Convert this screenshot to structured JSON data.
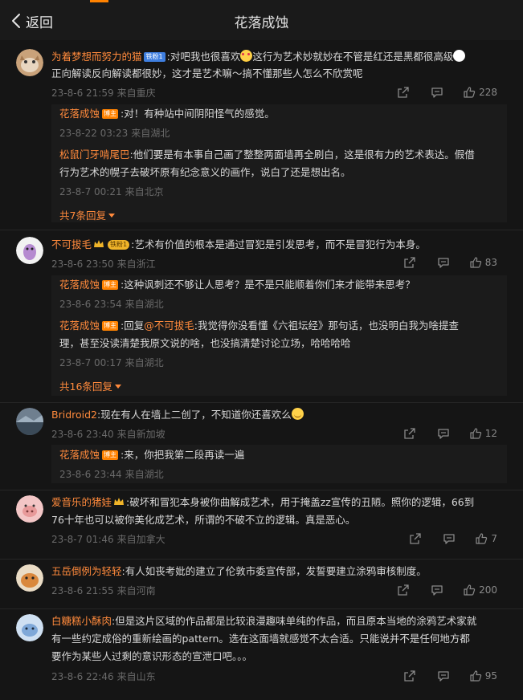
{
  "header": {
    "back_label": "返回",
    "title": "花落成蚀"
  },
  "comments": [
    {
      "username": "为着梦想而努力的猫",
      "badge": "铁粉1",
      "text_line1": ":对吧我也很喜欢",
      "text_line1b": "这行为艺术妙就妙在不管是红还是黑都很高级",
      "text_line2": "正向解读反向解读都很妙，这才是艺术嘛～搞不懂那些人怎么不欣赏呢",
      "time": "23-8-6 21:59",
      "location": "来自重庆",
      "likes": "228",
      "replies": [
        {
          "username": "花落成蚀",
          "badge": "博主",
          "text": ":对！有种站中间阴阳怪气的感觉。",
          "time": "23-8-22 03:23",
          "location": "来自湖北"
        },
        {
          "username": "松鼠门牙啃尾巴",
          "text1": ":他们要是有本事自己画了整整两面墙再全刷白，这是很有力的艺术表达。假借",
          "text2": "行为艺术的幌子去破坏原有纪念意义的画作，说白了还是想出名。",
          "time": "23-8-7 00:21",
          "location": "来自北京"
        }
      ],
      "more": "共7条回复"
    },
    {
      "username": "不可拔毛",
      "badge": "铁粉1",
      "text": ":艺术有价值的根本是通过冒犯是引发思考，而不是冒犯行为本身。",
      "time": "23-8-6 23:50",
      "location": "来自浙江",
      "likes": "83",
      "replies": [
        {
          "username": "花落成蚀",
          "badge": "博主",
          "text": ":这种讽刺还不够让人思考？是不是只能顺着你们来才能带来思考？",
          "time": "23-8-6 23:54",
          "location": "来自湖北"
        },
        {
          "username": "花落成蚀",
          "badge": "博主",
          "text_pre": ":回复",
          "mention": "@不可拔毛",
          "text1": ":我觉得你没看懂《六祖坛经》那句话，也没明白我为啥提查",
          "text2": "理，甚至没读清楚我原文说的啥，也没搞清楚讨论立场，哈哈哈哈",
          "time": "23-8-7 00:17",
          "location": "来自湖北"
        }
      ],
      "more": "共16条回复"
    },
    {
      "username": "Bridroid2",
      "text": ":现在有人在墙上二创了，不知道你还喜欢么",
      "time": "23-8-6 23:40",
      "location": "来自新加坡",
      "likes": "12",
      "replies": [
        {
          "username": "花落成蚀",
          "badge": "博主",
          "text": ":来，你把我第二段再读一遍",
          "time": "23-8-6 23:44",
          "location": "来自湖北"
        }
      ]
    },
    {
      "username": "爱音乐的猪娃",
      "text1": ":破坏和冒犯本身被你曲解成艺术，用于掩盖zz宣传的丑陋。照你的逻辑，66到",
      "text2": "76十年也可以被你美化成艺术，所谓的不破不立的逻辑。真是恶心。",
      "time": "23-8-7 01:46",
      "location": "来自加拿大",
      "likes": "7"
    },
    {
      "username": "五岳倒例为轻轻",
      "text": ":有人如丧考妣的建立了伦敦市委宣传部，发誓要建立涂鸦审核制度。",
      "time": "23-8-6 21:55",
      "location": "来自河南",
      "likes": "200"
    },
    {
      "username": "白糖糕小酥肉",
      "text1": ":但是这片区域的作品都是比较浪漫趣味单纯的作品，而且原本当地的涂鸦艺术家就",
      "text2": "有一些约定成俗的重新绘画的pattern。选在这面墙就感觉不太合适。只能说并不是任何地方都",
      "text3": "要作为某些人过剩的意识形态的宣泄口吧。。。",
      "time": "23-8-6 22:46",
      "location": "来自山东",
      "likes": "95"
    }
  ],
  "colors": {
    "accent": "#ff8200",
    "username": "#ff8a3c",
    "background": "#151515"
  },
  "icons": [
    "back-arrow-icon",
    "share-icon",
    "comment-icon",
    "like-icon"
  ]
}
